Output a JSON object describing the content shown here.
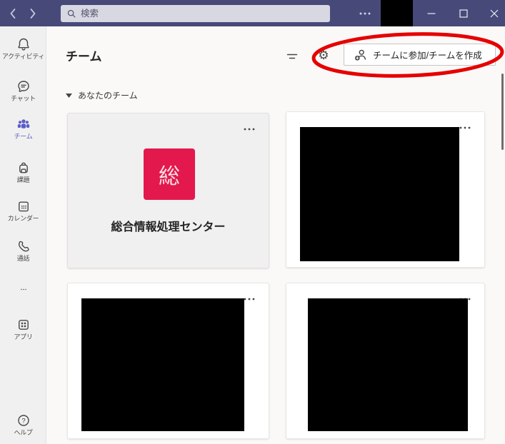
{
  "titlebar": {
    "search_placeholder": "検索"
  },
  "sidebar": {
    "items": [
      {
        "id": "activity",
        "label": "アクティビティ",
        "active": false
      },
      {
        "id": "chat",
        "label": "チャット",
        "active": false
      },
      {
        "id": "teams",
        "label": "チーム",
        "active": true
      },
      {
        "id": "assignments",
        "label": "課題",
        "active": false
      },
      {
        "id": "calendar",
        "label": "カレンダー",
        "active": false
      },
      {
        "id": "calls",
        "label": "通話",
        "active": false
      },
      {
        "id": "apps",
        "label": "アプリ",
        "active": false
      },
      {
        "id": "help",
        "label": "ヘルプ",
        "active": false
      }
    ]
  },
  "header": {
    "title": "チーム",
    "join_create_button": "チームに参加/チームを作成"
  },
  "section": {
    "label": "あなたのチーム"
  },
  "teams": {
    "cards": [
      {
        "name": "総合情報処理センター",
        "avatar_letter": "総",
        "avatar_color": "#E3184C",
        "redacted": false
      },
      {
        "name": "",
        "redacted": true
      },
      {
        "name": "",
        "redacted": true
      },
      {
        "name": "",
        "redacted": true
      }
    ]
  },
  "annotation": {
    "shape": "ellipse",
    "color": "#E60000",
    "target": "join_create_button"
  },
  "colors": {
    "titlebar": "#474A79",
    "accent": "#5B5FC7",
    "rail_bg": "#F0F0F0",
    "avatar_red": "#E3184C"
  }
}
